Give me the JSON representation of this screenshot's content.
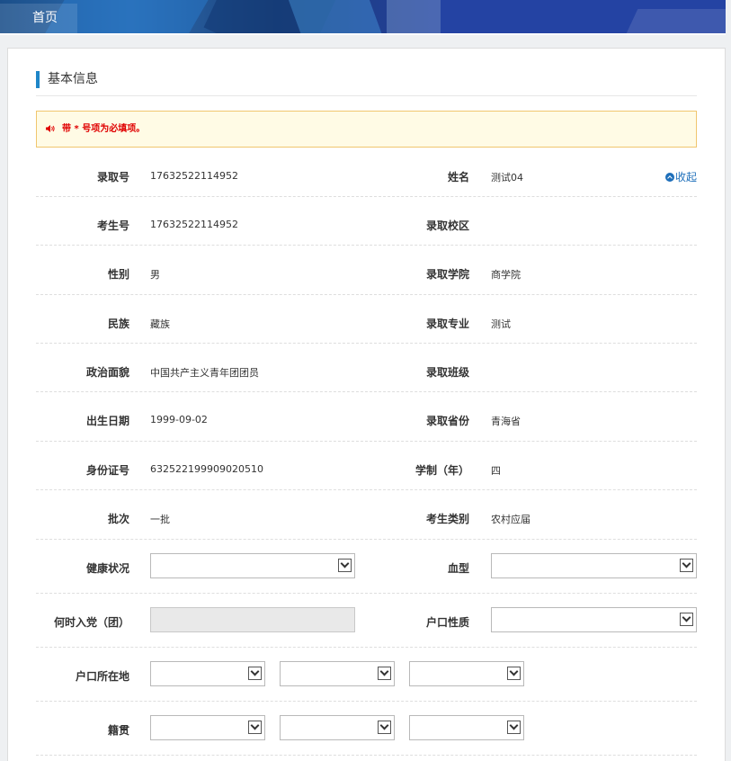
{
  "header": {
    "home_tab": "首页"
  },
  "section": {
    "title": "基本信息"
  },
  "notice": {
    "text": "带 * 号项为必填项。"
  },
  "collapse_label": "收起",
  "rows": [
    {
      "l1": "录取号",
      "v1": "17632522114952",
      "l2": "姓名",
      "v2": "测试04"
    },
    {
      "l1": "考生号",
      "v1": "17632522114952",
      "l2": "录取校区",
      "v2": ""
    },
    {
      "l1": "性别",
      "v1": "男",
      "l2": "录取学院",
      "v2": "商学院"
    },
    {
      "l1": "民族",
      "v1": "藏族",
      "l2": "录取专业",
      "v2": "测试"
    },
    {
      "l1": "政治面貌",
      "v1": "中国共产主义青年团团员",
      "l2": "录取班级",
      "v2": ""
    },
    {
      "l1": "出生日期",
      "v1": "1999-09-02",
      "l2": "录取省份",
      "v2": "青海省"
    },
    {
      "l1": "身份证号",
      "v1": "632522199909020510",
      "l2": "学制（年）",
      "v2": "四"
    },
    {
      "l1": "批次",
      "v1": "一批",
      "l2": "考生类别",
      "v2": "农村应届"
    }
  ],
  "form_rows": {
    "health": {
      "label": "健康状况",
      "value": ""
    },
    "blood": {
      "label": "血型",
      "value": ""
    },
    "party_time": {
      "label": "何时入党（团）",
      "value": ""
    },
    "hukou_type": {
      "label": "户口性质",
      "value": ""
    },
    "hukou_location": {
      "label": "户口所在地",
      "values": [
        "",
        "",
        ""
      ]
    },
    "native_place": {
      "label": "籍贯",
      "values": [
        "",
        "",
        ""
      ]
    }
  }
}
